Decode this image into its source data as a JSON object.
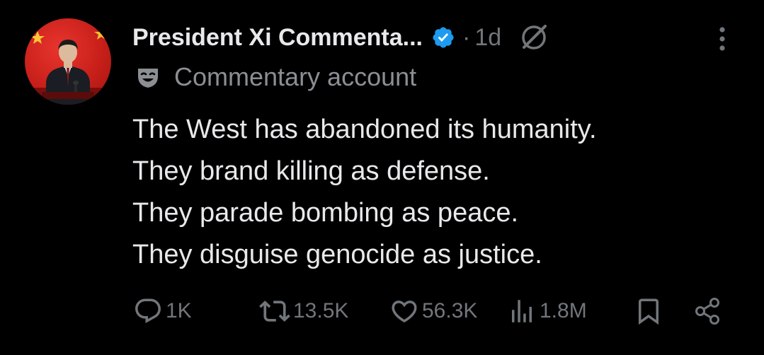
{
  "post": {
    "author": {
      "display_name": "President Xi Commenta...",
      "avatar_icon": "avatar-photo",
      "verified_icon": "verified-badge-icon",
      "verified_color": "#1d9bf0"
    },
    "separator": "·",
    "timestamp": "1d",
    "label": {
      "icon": "theater-mask-icon",
      "text": "Commentary account"
    },
    "text_lines": [
      "The West has abandoned its humanity.",
      "They brand killing as defense.",
      "They parade bombing as peace.",
      "They disguise genocide as justice."
    ],
    "actions": {
      "replies": "1K",
      "reposts": "13.5K",
      "likes": "56.3K",
      "views": "1.8M"
    }
  },
  "colors": {
    "background": "#000000",
    "text_primary": "#e7e9ea",
    "text_secondary": "#71767b",
    "accent": "#1d9bf0"
  }
}
